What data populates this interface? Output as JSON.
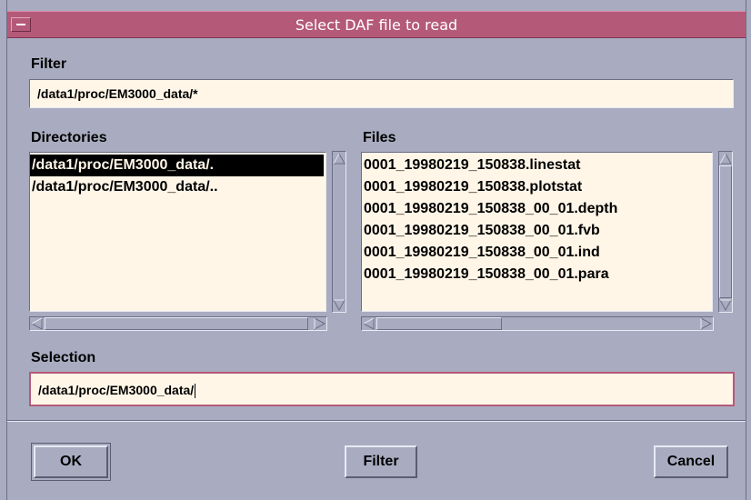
{
  "window": {
    "title": "Select DAF file to read"
  },
  "filter": {
    "label": "Filter",
    "value": "/data1/proc/EM3000_data/*"
  },
  "directories": {
    "label": "Directories",
    "items": [
      {
        "text": "/data1/proc/EM3000_data/.",
        "selected": true
      },
      {
        "text": "/data1/proc/EM3000_data/..",
        "selected": false
      }
    ]
  },
  "files": {
    "label": "Files",
    "items": [
      "0001_19980219_150838.linestat",
      "0001_19980219_150838.plotstat",
      "0001_19980219_150838_00_01.depth",
      "0001_19980219_150838_00_01.fvb",
      "0001_19980219_150838_00_01.ind",
      "0001_19980219_150838_00_01.para"
    ]
  },
  "selection": {
    "label": "Selection",
    "value": "/data1/proc/EM3000_data/"
  },
  "buttons": {
    "ok": "OK",
    "filter": "Filter",
    "cancel": "Cancel"
  },
  "icons": {
    "window_menu": "window-menu-icon",
    "scroll_up": "triangle-up-icon",
    "scroll_down": "triangle-down-icon",
    "scroll_left": "triangle-left-icon",
    "scroll_right": "triangle-right-icon"
  },
  "colors": {
    "titlebar": "#b45a78",
    "background": "#a9acc0",
    "field": "#fff6e8",
    "selection": "#000000"
  }
}
